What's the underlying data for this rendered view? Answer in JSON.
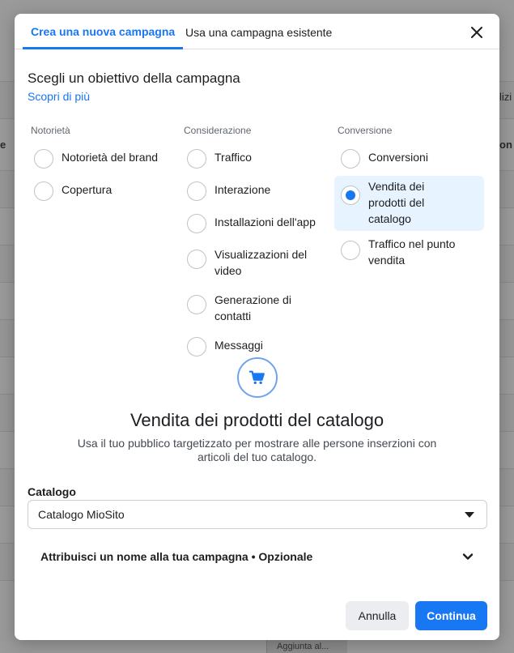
{
  "background": {
    "edge_left": "e",
    "edge_right_top": "lizi",
    "edge_right": "on",
    "bottom_cell": "Aggiunta al..."
  },
  "tabs": [
    {
      "label": "Crea una nuova campagna",
      "active": true
    },
    {
      "label": "Usa una campagna esistente",
      "active": false
    }
  ],
  "heading": "Scegli un obiettivo della campagna",
  "learn_more": "Scopri di più",
  "columns": [
    {
      "title": "Notorietà",
      "options": [
        {
          "label": "Notorietà del brand",
          "selected": false
        },
        {
          "label": "Copertura",
          "selected": false
        }
      ]
    },
    {
      "title": "Considerazione",
      "options": [
        {
          "label": "Traffico",
          "selected": false
        },
        {
          "label": "Interazione",
          "selected": false
        },
        {
          "label": "Installazioni dell'app",
          "selected": false
        },
        {
          "label": "Visualizzazioni del video",
          "selected": false
        },
        {
          "label": "Generazione di contatti",
          "selected": false
        },
        {
          "label": "Messaggi",
          "selected": false
        }
      ]
    },
    {
      "title": "Conversione",
      "options": [
        {
          "label": "Conversioni",
          "selected": false
        },
        {
          "label": "Vendita dei prodotti del catalogo",
          "selected": true
        },
        {
          "label": "Traffico nel punto vendita",
          "selected": false
        }
      ]
    }
  ],
  "objective": {
    "icon": "shopping-cart-icon",
    "title": "Vendita dei prodotti del catalogo",
    "description": "Usa il tuo pubblico targetizzato per mostrare alle persone inserzioni con articoli del tuo catalogo."
  },
  "catalog": {
    "label": "Catalogo",
    "value": "Catalogo MioSito"
  },
  "campaign_name": {
    "label": "Attribuisci un nome alla tua campagna • Opzionale"
  },
  "buttons": {
    "cancel": "Annulla",
    "continue": "Continua"
  },
  "colors": {
    "accent": "#1877f2",
    "selected_bg": "#e7f3ff"
  }
}
